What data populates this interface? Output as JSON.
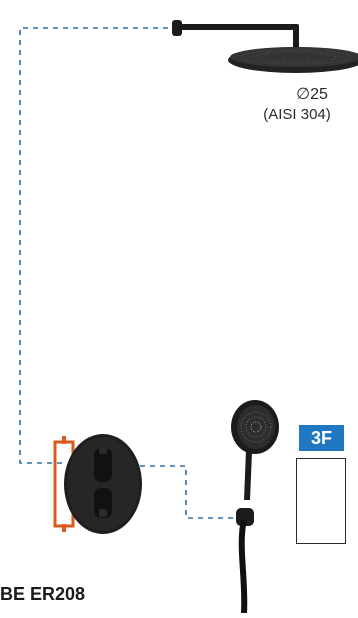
{
  "shower_head": {
    "diameter_label": "∅25",
    "material_label": "(AISI 304)"
  },
  "hand_shower": {
    "function_badge": "3F"
  },
  "product": {
    "code": "BE ER208"
  },
  "colors": {
    "finish": "#1b1b1b",
    "pipe_line": "#2f6ea8",
    "badge": "#1f78c1",
    "valve_frame": "#d9591e"
  },
  "icons": [
    "ceiling-shower-head-icon",
    "shower-arm-icon",
    "hand-shower-icon",
    "thermostatic-valve-icon",
    "hand-shower-spray-icon"
  ]
}
